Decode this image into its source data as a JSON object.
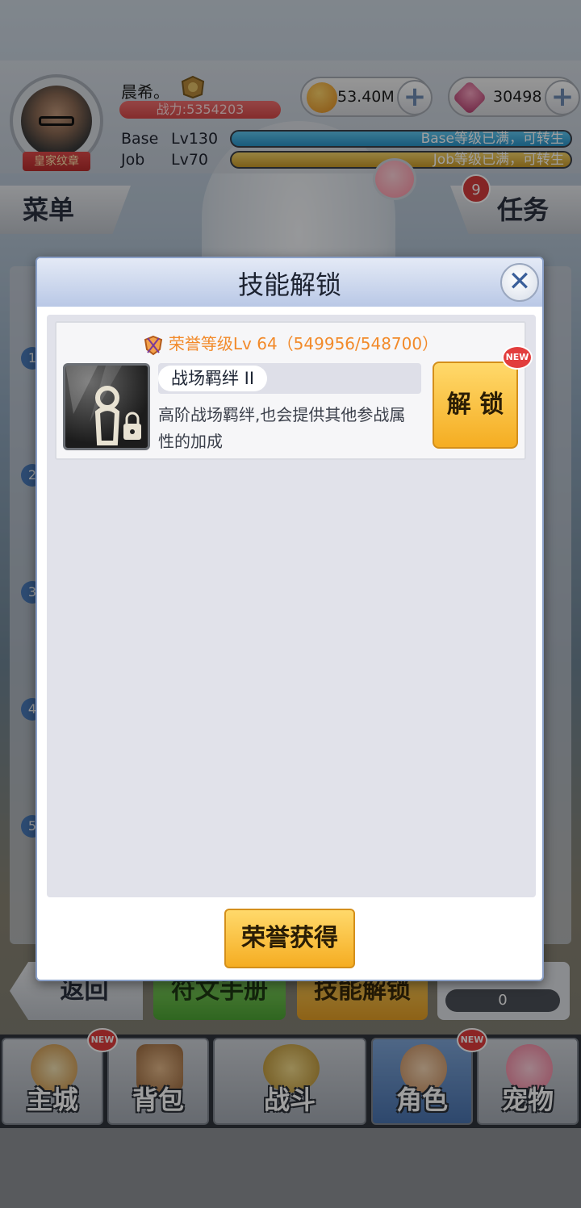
{
  "player": {
    "name": "晨希。",
    "badge": "皇家纹章",
    "power": "战力:5354203",
    "base_level_label": "Base",
    "base_level": "Lv130",
    "base_status": "Base等级已满，可转生",
    "job_level_label": "Job",
    "job_level": "Lv70",
    "job_status": "Job等级已满，可转生"
  },
  "currency": {
    "gold": "53.40M",
    "gems": "30498",
    "add_label": "+"
  },
  "side": {
    "menu_label": "菜单",
    "task_label": "任务",
    "task_count": "9"
  },
  "background_rows": [
    "1",
    "2",
    "3",
    "4",
    "5"
  ],
  "action_row": {
    "back_label": "返回",
    "rune_label": "符文手册",
    "skill_label": "技能解锁",
    "counter_value": "0"
  },
  "nav": {
    "tabs": [
      {
        "label": "主城",
        "new": "NEW"
      },
      {
        "label": "背包",
        "new": ""
      },
      {
        "label": "战斗",
        "new": ""
      },
      {
        "label": "角色",
        "new": "NEW"
      },
      {
        "label": "宠物",
        "new": ""
      }
    ],
    "active_index": 3
  },
  "modal": {
    "title": "技能解锁",
    "close_icon": "✕",
    "card": {
      "honor_requirement": "荣誉等级Lv 64（549956/548700）",
      "skill_name": "战场羁绊 II",
      "description": "高阶战场羁绊,也会提供其他参战属性的加成",
      "unlock_label": "解 锁",
      "new_badge": "NEW"
    },
    "honor_button_label": "荣誉获得"
  },
  "colors": {
    "honor_orange": "#f28a2a",
    "button_gold": "#f5ad22",
    "modal_header": "#b9c8e6"
  },
  "icons": [
    "gold-coin-icon",
    "gem-icon",
    "plus-icon",
    "close-icon",
    "honor-shield-icon",
    "skill-locked-icon",
    "pet-icon",
    "rank-medal-icon"
  ]
}
